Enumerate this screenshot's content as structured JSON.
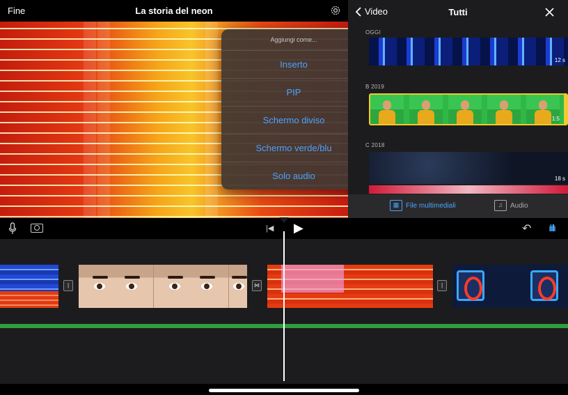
{
  "editor": {
    "done_label": "Fine",
    "project_title": "La storia del neon"
  },
  "popover": {
    "header": "Aggiungi come...",
    "options": [
      "Inserto",
      "PIP",
      "Schermo diviso",
      "Schermo verde/blu",
      "Solo audio"
    ]
  },
  "browser": {
    "back_label": "Video",
    "title": "Tutti",
    "sections": [
      {
        "label": "OGGI",
        "duration": "12 s"
      },
      {
        "label": "B 2019",
        "duration": "1:5"
      },
      {
        "label": "C 2018",
        "duration": "18 s"
      }
    ],
    "tabs": [
      {
        "label": "File multimediali",
        "active": true
      },
      {
        "label": "Audio",
        "active": false
      }
    ]
  },
  "colors": {
    "accent": "#4aa3ff",
    "selection": "#f2c92e",
    "audio_track": "#2e9e3f"
  },
  "icons": {
    "settings": "gear-icon",
    "back": "chevron-left-icon",
    "close": "close-icon",
    "mic": "microphone-icon",
    "camera": "camera-icon",
    "skip_back": "skip-to-start-icon",
    "play": "play-icon",
    "undo": "undo-icon",
    "audio_wave": "waveform-icon"
  }
}
